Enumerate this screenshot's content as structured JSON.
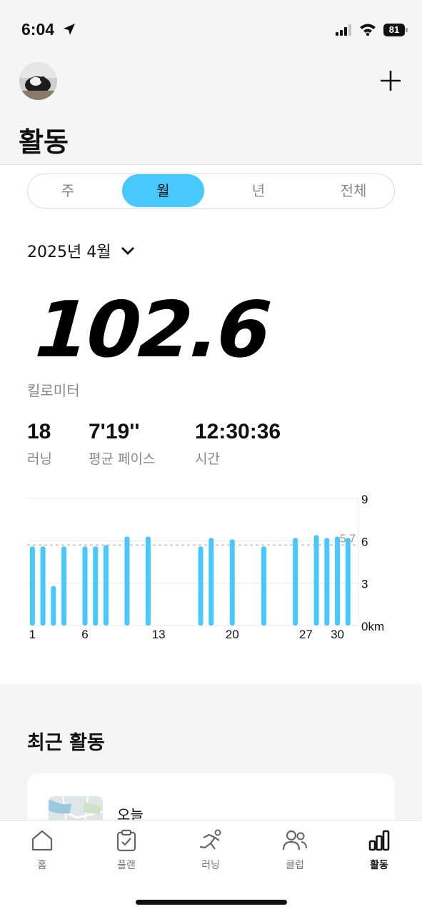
{
  "status_bar": {
    "time": "6:04",
    "battery": "81"
  },
  "header": {
    "title": "활동"
  },
  "segments": [
    {
      "label": "주",
      "active": false
    },
    {
      "label": "월",
      "active": true
    },
    {
      "label": "년",
      "active": false
    },
    {
      "label": "전체",
      "active": false
    }
  ],
  "date_picker": {
    "label": "2025년 4월"
  },
  "summary": {
    "distance": "102.6",
    "unit": "킬로미터",
    "stats": [
      {
        "value": "18",
        "label": "러닝"
      },
      {
        "value": "7'19''",
        "label": "평균 페이스"
      },
      {
        "value": "12:30:36",
        "label": "시간"
      }
    ]
  },
  "chart_data": {
    "type": "bar",
    "x": [
      1,
      2,
      3,
      4,
      6,
      7,
      8,
      10,
      12,
      17,
      18,
      20,
      23,
      26,
      28,
      29,
      30,
      31
    ],
    "values": [
      5.6,
      5.6,
      2.8,
      5.6,
      5.6,
      5.6,
      5.7,
      6.3,
      6.3,
      5.6,
      6.2,
      6.1,
      5.6,
      6.2,
      6.4,
      6.2,
      6.3,
      6.2
    ],
    "x_tick_labels": [
      "1",
      "6",
      "13",
      "20",
      "27",
      "30"
    ],
    "x_ticks": [
      1,
      6,
      13,
      20,
      27,
      30
    ],
    "y_ticks": [
      0,
      3,
      6,
      9
    ],
    "y_tick_labels": [
      "0km",
      "3",
      "6",
      "9"
    ],
    "ylim": [
      0,
      9
    ],
    "xlim": [
      0.5,
      32
    ],
    "average": 5.7,
    "average_label": "5.7",
    "color": "#47c8ff",
    "grid": true
  },
  "recent": {
    "title": "최근 활동",
    "items": [
      {
        "label": "오늘"
      }
    ]
  },
  "tab_bar": {
    "items": [
      {
        "label": "홈",
        "icon": "home-icon",
        "active": false
      },
      {
        "label": "플랜",
        "icon": "clipboard-check-icon",
        "active": false
      },
      {
        "label": "러닝",
        "icon": "runner-icon",
        "active": false
      },
      {
        "label": "클럽",
        "icon": "people-icon",
        "active": false
      },
      {
        "label": "활동",
        "icon": "bar-chart-icon",
        "active": true
      }
    ]
  },
  "colors": {
    "accent": "#47c8ff",
    "background_gray": "#f5f5f5"
  }
}
